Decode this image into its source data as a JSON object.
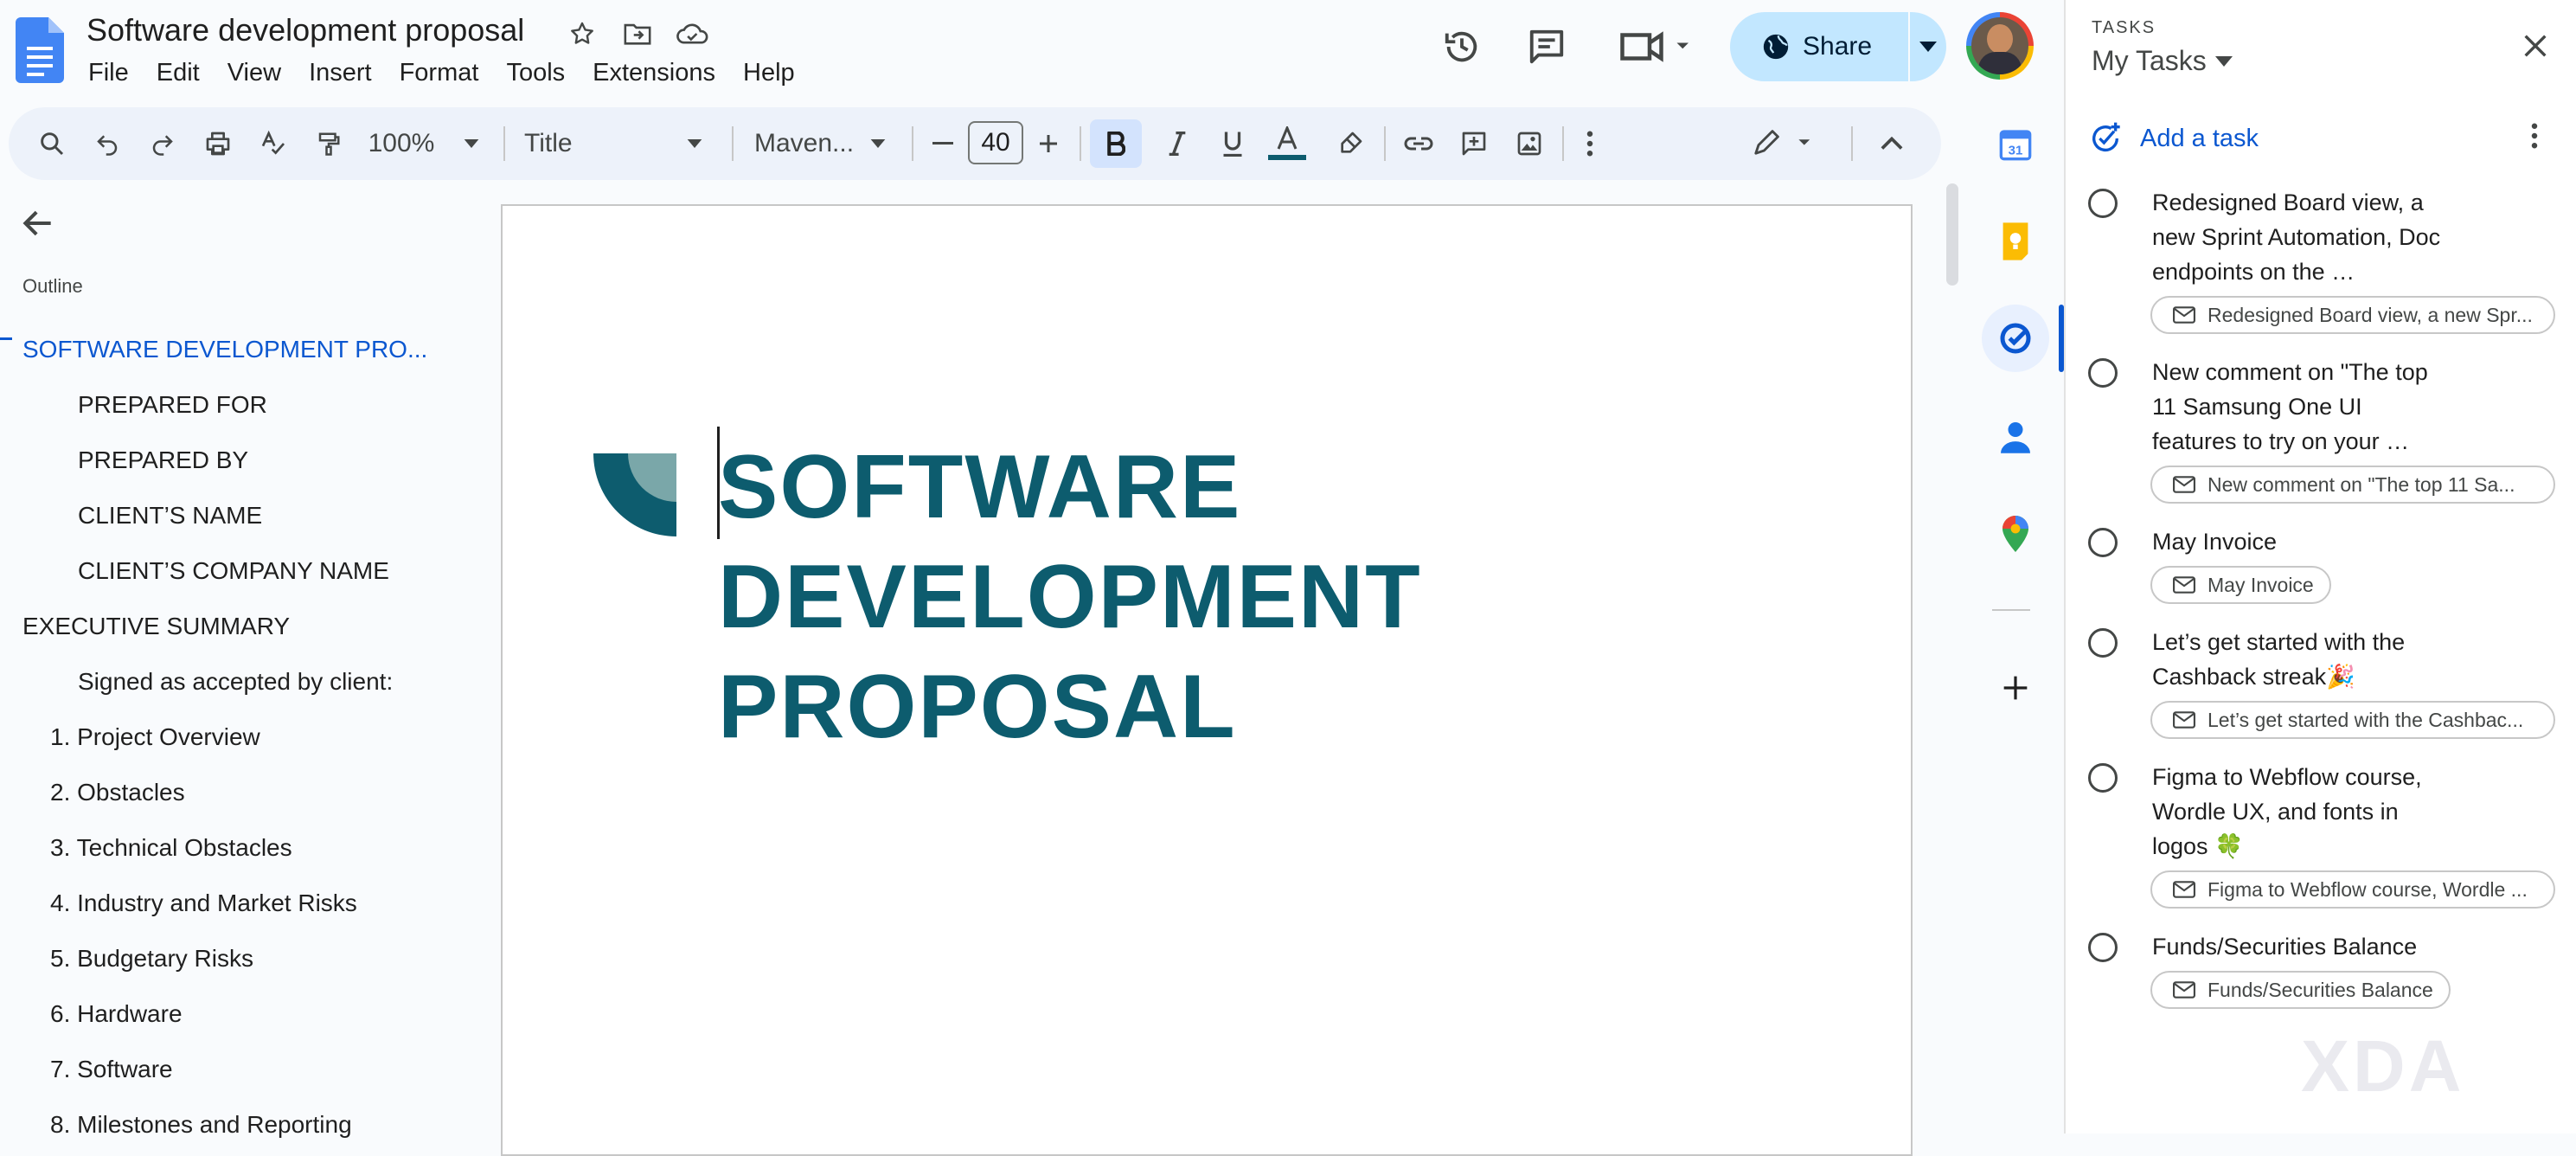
{
  "document": {
    "title": "Software development proposal",
    "menu": [
      "File",
      "Edit",
      "View",
      "Insert",
      "Format",
      "Tools",
      "Extensions",
      "Help"
    ]
  },
  "header": {
    "share_label": "Share"
  },
  "toolbar": {
    "zoom": "100%",
    "style": "Title",
    "font": "Maven...",
    "font_size": "40"
  },
  "outline": {
    "heading": "Outline",
    "items": [
      "SOFTWARE DEVELOPMENT PRO...",
      "PREPARED FOR",
      "PREPARED BY",
      "CLIENT’S NAME",
      "CLIENT’S COMPANY NAME",
      "EXECUTIVE SUMMARY",
      "Signed as accepted by client:",
      "1. Project Overview",
      "2. Obstacles",
      "3. Technical Obstacles",
      "4. Industry and Market Risks",
      "5. Budgetary Risks",
      "6. Hardware",
      "7. Software",
      "8. Milestones and Reporting"
    ]
  },
  "page": {
    "heading_lines": [
      "SOFTWARE",
      "DEVELOPMENT",
      "PROPOSAL"
    ]
  },
  "tasks": {
    "kicker": "TASKS",
    "list_name": "My Tasks",
    "add_label": "Add a task",
    "items": [
      {
        "title": "Redesigned Board view, a new Sprint Automation, Doc endpoints on the …",
        "chip": "Redesigned Board view, a new Spr..."
      },
      {
        "title": "New comment on \"The top 11 Samsung One UI features to try on your …",
        "chip": "New comment on \"The top 11 Sa..."
      },
      {
        "title": "May Invoice",
        "chip": "May Invoice"
      },
      {
        "title": "Let’s get started with the Cashback streak🎉",
        "chip": "Let’s get started with the Cashbac..."
      },
      {
        "title": "Figma to Webflow course, Wordle UX, and fonts in logos 🍀",
        "chip": "Figma to Webflow course, Wordle ..."
      },
      {
        "title": "Funds/Securities Balance",
        "chip": "Funds/Securities Balance"
      }
    ]
  },
  "colors": {
    "accent": "#0b57d0",
    "heading_teal": "#0d5c6e",
    "share_bg": "#c2e7ff"
  },
  "watermark": "XDA"
}
